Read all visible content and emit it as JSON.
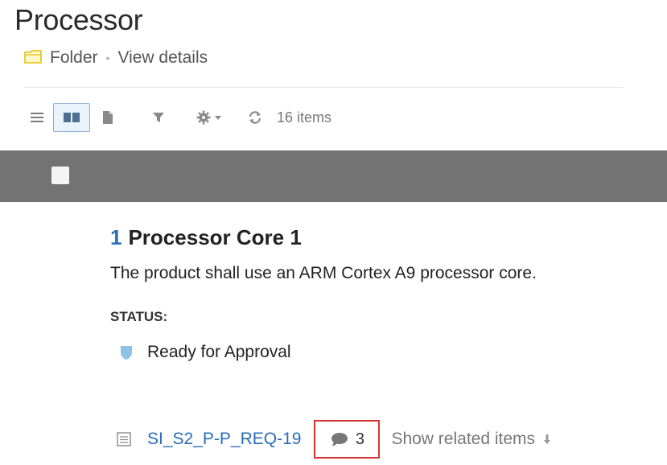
{
  "page": {
    "title": "Processor",
    "type_label": "Folder",
    "separator": "•",
    "view_details": "View details"
  },
  "toolbar": {
    "item_count": "16 items",
    "icons": [
      "list-view-icon",
      "card-view-icon",
      "document-view-icon",
      "filter-icon",
      "gear-icon",
      "refresh-icon"
    ]
  },
  "item": {
    "number": "1",
    "title": "Processor Core 1",
    "description": "The product shall use an ARM Cortex A9 processor core.",
    "status_label": "STATUS:",
    "status_value": "Ready for Approval",
    "id": "SI_S2_P-P_REQ-19",
    "comment_count": "3",
    "related_label": "Show related items"
  },
  "colors": {
    "accent_blue": "#2a6db8",
    "band_gray": "#737373",
    "highlight_red": "#d83434",
    "status_shield": "#8fc3e6",
    "folder_yellow": "#e8c62a"
  }
}
